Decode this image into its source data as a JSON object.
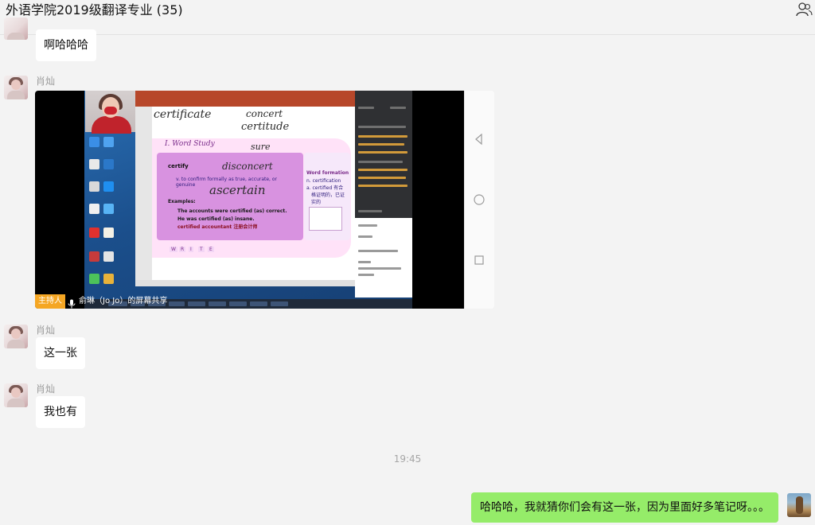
{
  "header": {
    "title": "外语学院2019级翻译专业 (35)",
    "members_icon": "group-members-icon"
  },
  "messages": [
    {
      "sender": "",
      "text": "啊哈哈哈"
    },
    {
      "sender": "肖灿",
      "type": "screen-share"
    },
    {
      "sender": "肖灿",
      "text": "这一张"
    },
    {
      "sender": "肖灿",
      "text": "我也有"
    }
  ],
  "share": {
    "host_tag": "主持人",
    "share_label": "俞琳（Jo Jo）的屏幕共享",
    "side_icons": [
      "back-triangle-icon",
      "home-circle-icon",
      "recent-square-icon"
    ]
  },
  "slide": {
    "handwriting": [
      "certificate",
      "concert",
      "certitude",
      "sure",
      "disconcert",
      "ascertain"
    ],
    "section_title": "I. Word Study",
    "word": "certify",
    "definition": "v. to confirm formally as true, accurate, or genuine",
    "examples_label": "Examples:",
    "examples": [
      "The accounts were certified (as) correct.",
      "He was certified (as) insane.",
      "certified accountant 注册会计师"
    ],
    "word_formation_title": "Word formation",
    "word_formation": [
      "n. certification",
      "a. certified 有合",
      "格证明的，已证",
      "实的"
    ],
    "write_letters": [
      "W",
      "R",
      "I",
      "T",
      "E"
    ]
  },
  "timestamp": "19:45",
  "outgoing": {
    "text": "哈哈哈，我就猜你们会有这一张，因为里面好多笔记呀。。。"
  },
  "colors": {
    "bubble_me": "#95ec69",
    "bubble_other": "#ffffff",
    "host_tag": "#f5a623",
    "slide_purple": "#d892e0"
  }
}
